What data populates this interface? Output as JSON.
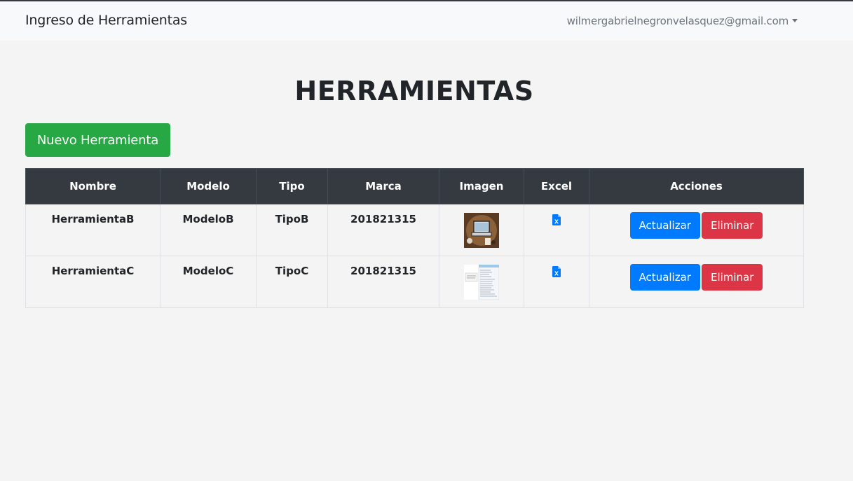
{
  "navbar": {
    "brand": "Ingreso de Herramientas",
    "user_email": "wilmergabrielnegronvelasquez@gmail.com"
  },
  "page": {
    "title": "HERRAMIENTAS",
    "new_button_label": "Nuevo Herramienta"
  },
  "table": {
    "headers": [
      "Nombre",
      "Modelo",
      "Tipo",
      "Marca",
      "Imagen",
      "Excel",
      "Acciones"
    ],
    "rows": [
      {
        "nombre": "HerramientaB",
        "modelo": "ModeloB",
        "tipo": "TipoB",
        "marca": "201821315",
        "imagen_icon": "laptop-photo-thumbnail",
        "excel_icon": "excel-file-icon",
        "update_label": "Actualizar",
        "delete_label": "Eliminar"
      },
      {
        "nombre": "HerramientaC",
        "modelo": "ModeloC",
        "tipo": "TipoC",
        "marca": "201821315",
        "imagen_icon": "document-screenshot-thumbnail",
        "excel_icon": "excel-file-icon",
        "update_label": "Actualizar",
        "delete_label": "Eliminar"
      }
    ]
  },
  "colors": {
    "navbar_bg": "#f8f9fa",
    "page_bg": "#f4f4f4",
    "table_header_bg": "#343a40",
    "success": "#28a745",
    "primary": "#007bff",
    "danger": "#dc3545"
  }
}
